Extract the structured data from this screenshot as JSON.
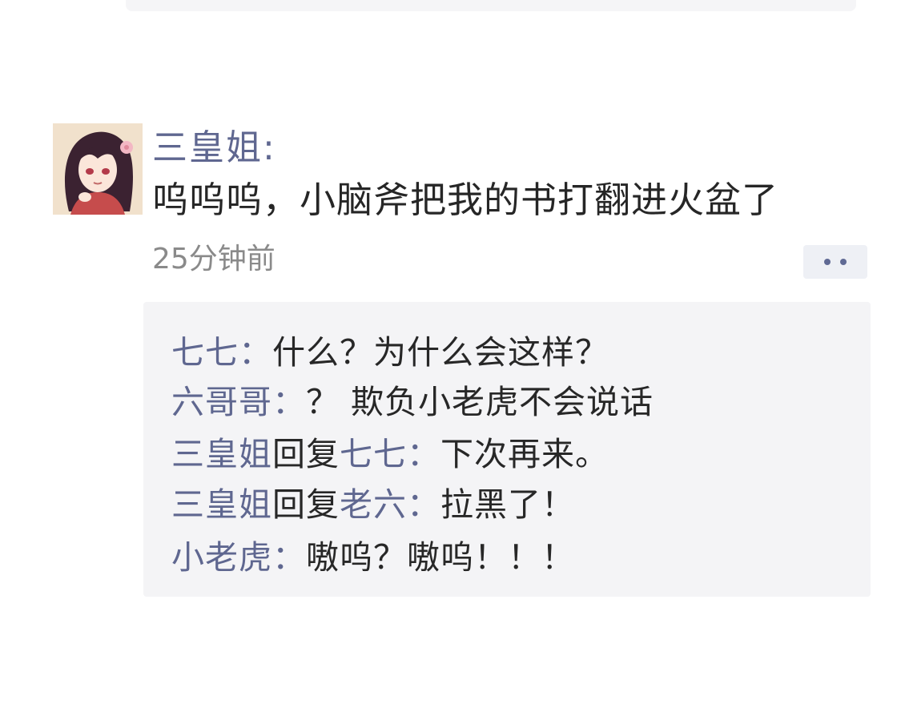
{
  "post": {
    "author": "三皇姐:",
    "message": "呜呜呜，小脑斧把我的书打翻进火盆了",
    "timestamp": "25分钟前"
  },
  "icons": {
    "avatar": "anime-girl-avatar",
    "more": "more-dots-icon"
  },
  "comments": [
    {
      "name": "七七",
      "colon": "：",
      "text": "什么？为什么会这样？"
    },
    {
      "name": "六哥哥",
      "colon": "：",
      "text": "？ 欺负小老虎不会说话"
    },
    {
      "name": "三皇姐",
      "reply_word": "回复",
      "reply_to": "七七",
      "colon": "：",
      "text": "下次再来。"
    },
    {
      "name": "三皇姐",
      "reply_word": "回复",
      "reply_to": "老六",
      "colon": "：",
      "text": "拉黑了！"
    },
    {
      "name": "小老虎",
      "colon": "：",
      "text": "嗷呜？嗷呜！！！"
    }
  ],
  "colors": {
    "name": "#5f6790",
    "text": "#262626",
    "panel": "#f4f4f6"
  }
}
